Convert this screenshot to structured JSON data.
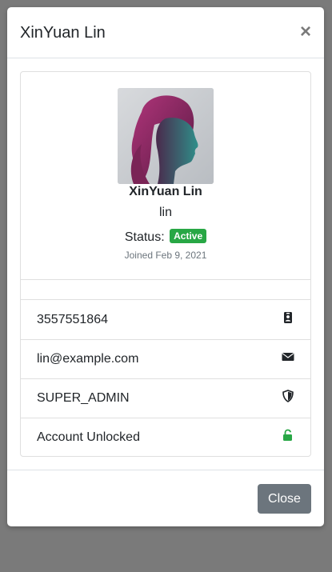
{
  "modal": {
    "title": "XinYuan Lin",
    "close_icon": "close-icon",
    "close_symbol": "×"
  },
  "profile": {
    "name": "XinYuan Lin",
    "username": "lin",
    "status_label": "Status:",
    "status_value": "Active",
    "joined": "Joined Feb 9, 2021"
  },
  "details": [
    {
      "text": "3557551864",
      "icon": "id-badge-icon"
    },
    {
      "text": "lin@example.com",
      "icon": "envelope-icon"
    },
    {
      "text": "SUPER_ADMIN",
      "icon": "shield-icon"
    },
    {
      "text": "Account Unlocked",
      "icon": "unlock-icon"
    }
  ],
  "footer": {
    "close_label": "Close"
  },
  "colors": {
    "backdrop": "#7a7a7a",
    "badge_active": "#28a745",
    "close_button": "#6c757d",
    "unlock_icon": "#28a745"
  }
}
